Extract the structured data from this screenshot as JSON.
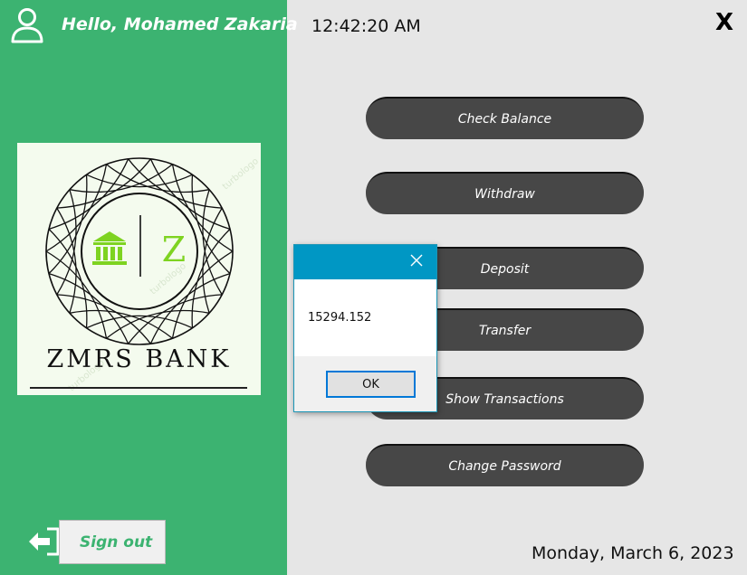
{
  "header": {
    "greeting": "Hello, Mohamed Zakaria",
    "time": "12:42:20 AM",
    "close_label": "X"
  },
  "logo": {
    "bank_name": "ZMRS BANK",
    "letter": "Z",
    "watermark": "turbologo"
  },
  "menu": [
    {
      "label": "Check Balance"
    },
    {
      "label": "Withdraw"
    },
    {
      "label": "Deposit"
    },
    {
      "label": "Transfer"
    },
    {
      "label": "Show Transactions"
    },
    {
      "label": "Change Password"
    }
  ],
  "dialog": {
    "message": "15294.152",
    "ok_label": "OK"
  },
  "sidebar": {
    "signout_label": "Sign out"
  },
  "footer": {
    "date": "Monday, March 6, 2023"
  },
  "icons": {
    "user": "user-icon",
    "signout": "sign-out-icon",
    "bank": "bank-icon",
    "close": "close-icon"
  },
  "colors": {
    "sidebar": "#3cb371",
    "button": "#474747",
    "dialog_title": "#0097c4",
    "logo_accent": "#7ed321"
  }
}
